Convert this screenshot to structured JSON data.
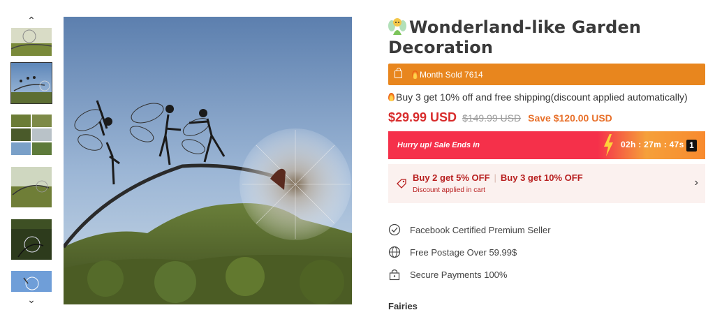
{
  "gallery": {
    "up_icon": "chevron-up-icon",
    "down_icon": "chevron-down-icon",
    "thumbnails": [
      {
        "alt": "thumbnail-1"
      },
      {
        "alt": "thumbnail-2"
      },
      {
        "alt": "thumbnail-3"
      },
      {
        "alt": "thumbnail-4"
      },
      {
        "alt": "thumbnail-5"
      },
      {
        "alt": "thumbnail-6"
      }
    ],
    "selected_index": 1
  },
  "product": {
    "title_emoji": "fairy-emoji-icon",
    "title": "Wonderland-like Garden Decoration",
    "sold_text": "Month Sold 7614",
    "promo_text": "Buy 3 get 10% off and free shipping(discount applied automatically)",
    "price": "$29.99 USD",
    "original_price": "$149.99 USD",
    "save_text": "Save $120.00 USD"
  },
  "sale": {
    "hurry_text": "Hurry up! Sale Ends in",
    "timer": "02h : 27m : 47s",
    "counter": "1"
  },
  "offers": {
    "offer_1": "Buy 2 get 5% OFF",
    "offer_2": "Buy 3 get 10% OFF",
    "note": "Discount applied in cart"
  },
  "features": [
    {
      "icon": "badge-check-icon",
      "label": "Facebook Certified Premium Seller"
    },
    {
      "icon": "globe-icon",
      "label": "Free Postage Over 59.99$"
    },
    {
      "icon": "lock-icon",
      "label": "Secure Payments 100%"
    }
  ],
  "section": {
    "title": "Fairies"
  },
  "colors": {
    "sold_bar": "#e8861e",
    "price": "#d82c2c",
    "sale_bar": "#f5304a",
    "offer_bg": "#fbf1ef"
  }
}
